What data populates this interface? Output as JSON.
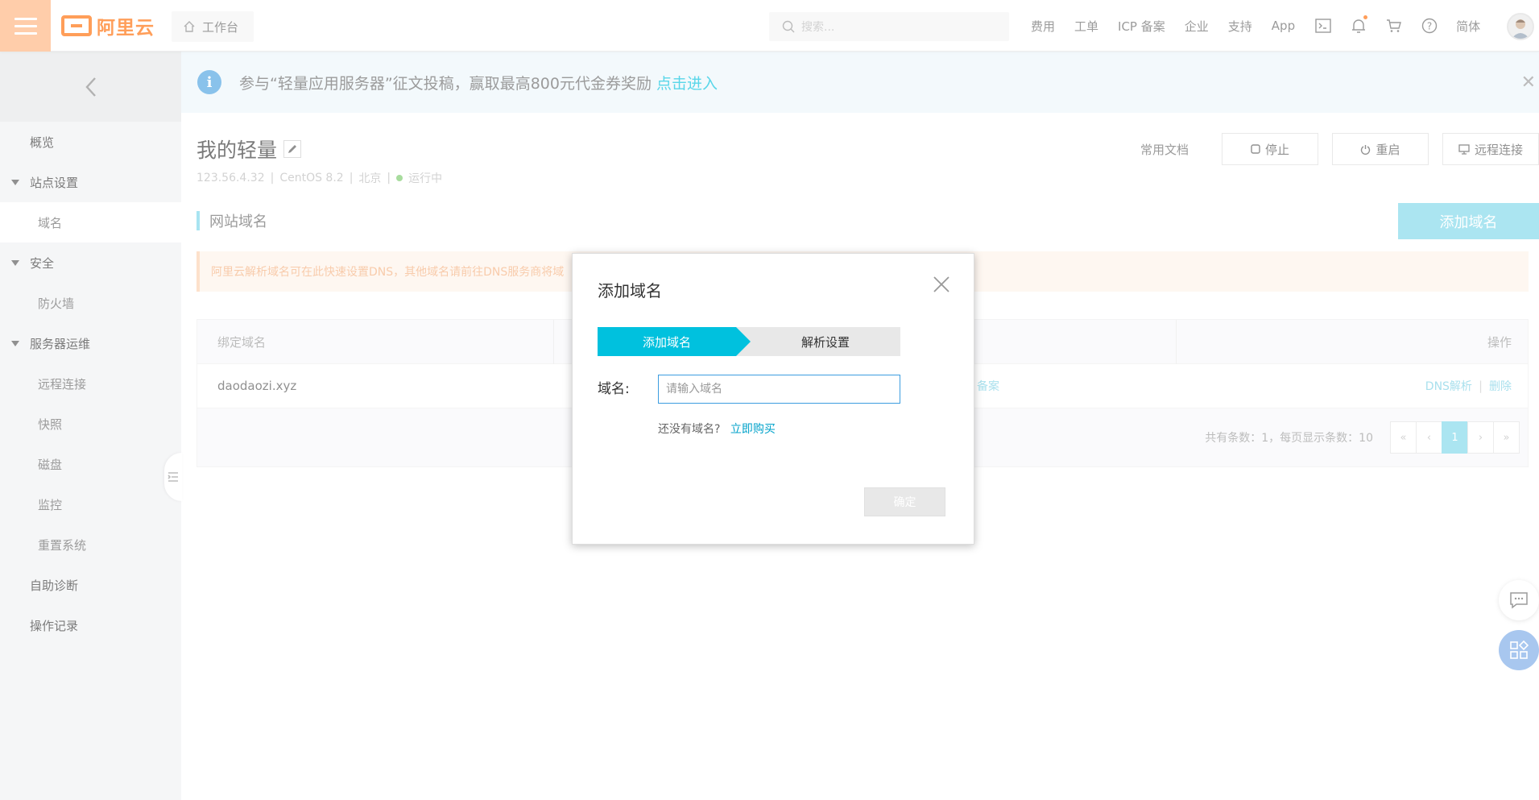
{
  "brand": {
    "name": "阿里云",
    "accent": "#ff6a00",
    "menu_bg": "#ffb37d"
  },
  "topbar": {
    "workbench_label": "工作台",
    "search_placeholder": "搜索...",
    "links": [
      "费用",
      "工单",
      "ICP 备案",
      "企业",
      "支持",
      "App"
    ],
    "language": "简体",
    "icons": [
      "terminal-icon",
      "bell-icon",
      "cart-icon",
      "help-icon"
    ]
  },
  "sidebar": {
    "items": [
      {
        "label": "概览",
        "kind": "top"
      },
      {
        "label": "站点设置",
        "kind": "group"
      },
      {
        "label": "域名",
        "kind": "sub",
        "active": true
      },
      {
        "label": "安全",
        "kind": "group"
      },
      {
        "label": "防火墙",
        "kind": "sub"
      },
      {
        "label": "服务器运维",
        "kind": "group"
      },
      {
        "label": "远程连接",
        "kind": "sub"
      },
      {
        "label": "快照",
        "kind": "sub"
      },
      {
        "label": "磁盘",
        "kind": "sub"
      },
      {
        "label": "监控",
        "kind": "sub"
      },
      {
        "label": "重置系统",
        "kind": "sub"
      },
      {
        "label": "自助诊断",
        "kind": "top"
      },
      {
        "label": "操作记录",
        "kind": "top"
      }
    ]
  },
  "notice": {
    "text": "参与“轻量应用服务器”征文投稿，赢取最高800元代金券奖励",
    "link": "点击进入"
  },
  "instance": {
    "title": "我的轻量",
    "ip": "123.56.4.32",
    "os": "CentOS 8.2",
    "region": "北京",
    "status": "运行中"
  },
  "actions": {
    "docs": "常用文档",
    "stop": "停止",
    "restart": "重启",
    "remote": "远程连接"
  },
  "domain_section": {
    "title": "网站域名",
    "add_button": "添加域名",
    "warning": "阿里云解析域名可在此快速设置DNS，其他域名请前往DNS服务商将域"
  },
  "table": {
    "headers": [
      "绑定域名",
      "",
      "",
      "操作"
    ],
    "rows": [
      {
        "domain": "daodaozi.xyz",
        "status_fragment": "备案",
        "ops": [
          "DNS解析",
          "删除"
        ]
      }
    ],
    "footer": "共有条数：1，每页显示条数：10",
    "pager": [
      "«",
      "‹",
      "1",
      "›",
      "»"
    ]
  },
  "modal": {
    "title": "添加域名",
    "steps": [
      "添加域名",
      "解析设置"
    ],
    "field_label": "域名:",
    "input_placeholder": "请输入域名",
    "input_value": "",
    "hint": "还没有域名?",
    "buy_link": "立即购买",
    "confirm": "确定"
  }
}
